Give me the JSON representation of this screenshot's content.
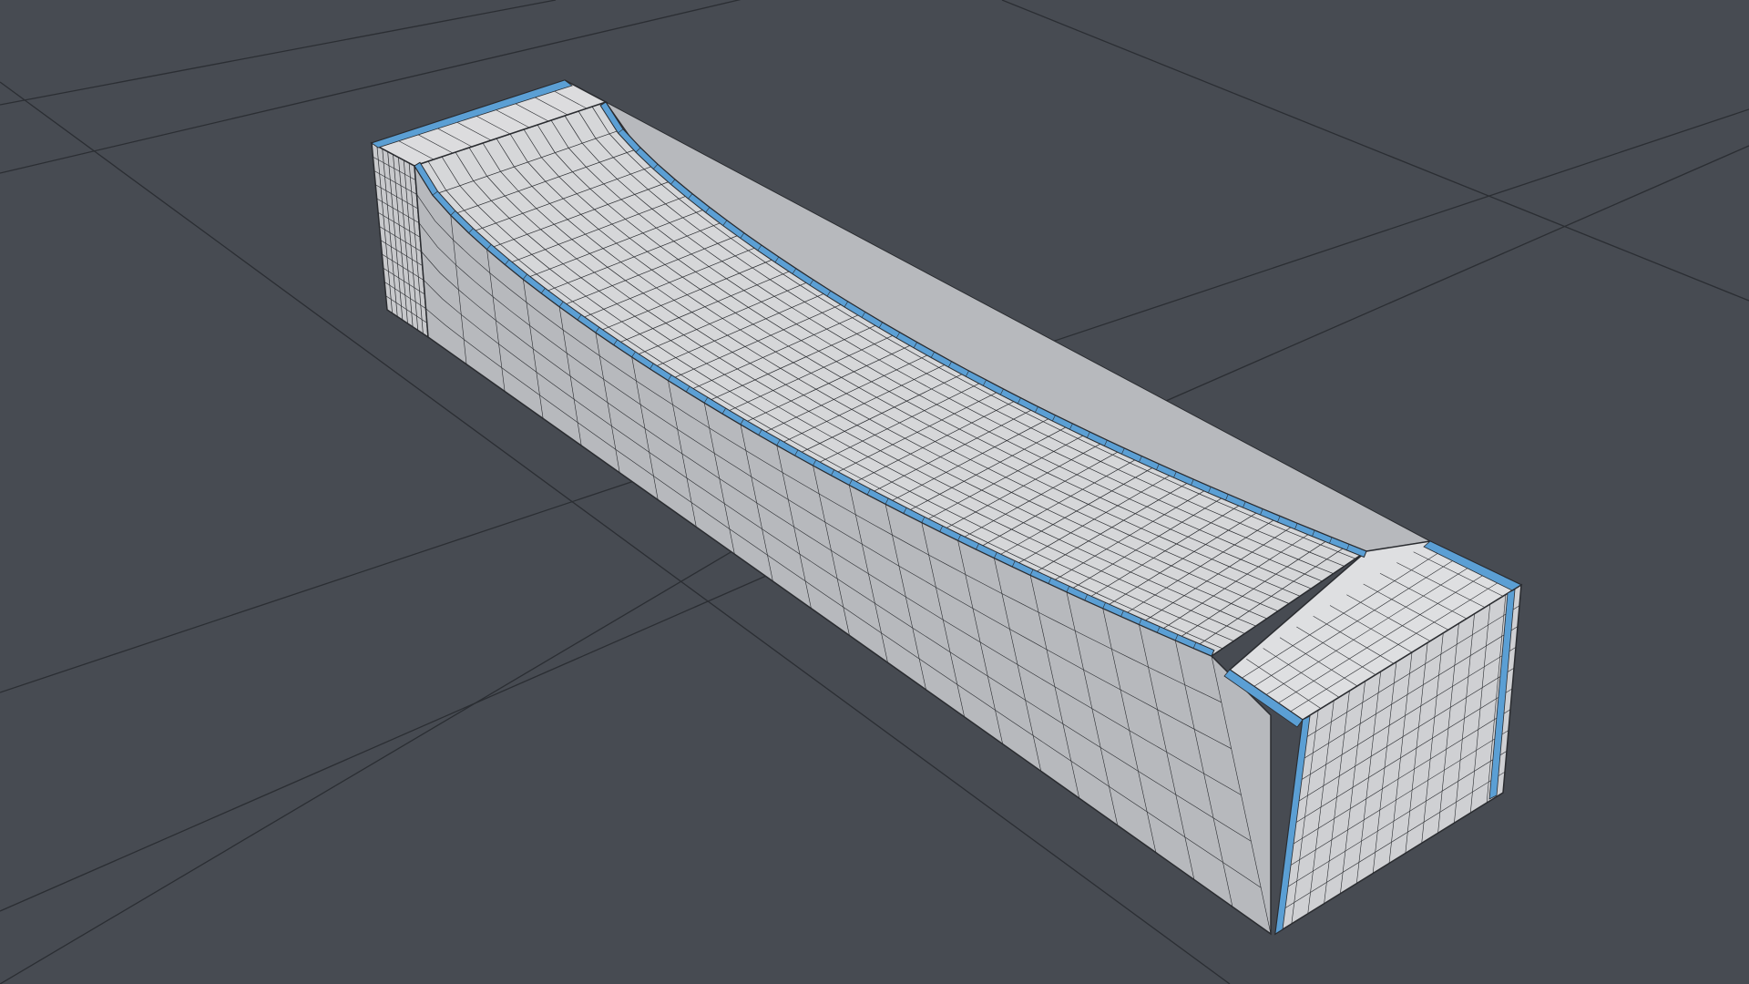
{
  "viewport": {
    "background": "#474b52",
    "floor_grid": {
      "visible": true,
      "color": "#2b2e33"
    }
  },
  "model": {
    "object": "half-pipe-ramp",
    "display": "wireframe-on-shaded",
    "surface_color": "#d6d7d9",
    "side_color": "#b7b9bd",
    "wire_color": "#2a2c30",
    "edge_loop_color": "#5b9fd4"
  }
}
